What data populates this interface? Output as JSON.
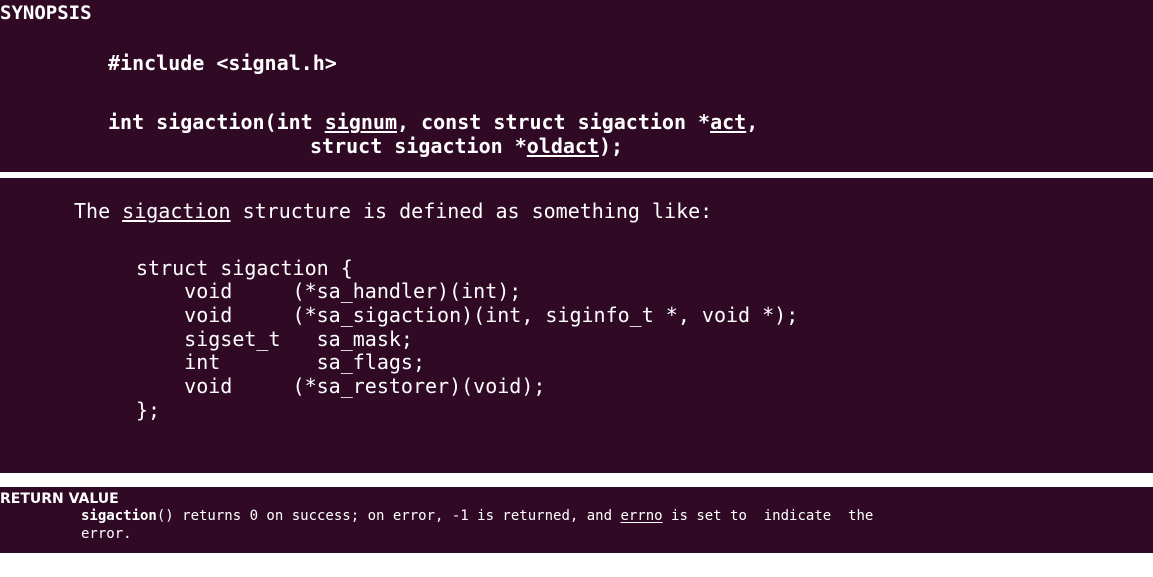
{
  "synopsis": {
    "heading": "SYNOPSIS",
    "include": "#include <signal.h>",
    "sig_prefix": "int sigaction(int ",
    "sig_param1": "signum",
    "sig_mid": ", const struct sigaction *",
    "sig_param2": "act",
    "sig_end1": ",",
    "sig_line2_prefix": "struct sigaction *",
    "sig_param3": "oldact",
    "sig_end2": ");"
  },
  "structure": {
    "intro_prefix": "The ",
    "intro_link": "sigaction",
    "intro_suffix": " structure is defined as something like:",
    "lines": [
      "struct sigaction {",
      "    void     (*sa_handler)(int);",
      "    void     (*sa_sigaction)(int, siginfo_t *, void *);",
      "    sigset_t   sa_mask;",
      "    int        sa_flags;",
      "    void     (*sa_restorer)(void);",
      "};"
    ]
  },
  "return_value": {
    "heading": "RETURN VALUE",
    "func": "sigaction",
    "text1": "() returns 0 on success; on error, -1 is returned, and ",
    "errno": "errno",
    "text2": " is set to  indicate  the",
    "text3": "error."
  },
  "colors": {
    "terminal_bg": "#300a24",
    "text": "#ffffff"
  }
}
